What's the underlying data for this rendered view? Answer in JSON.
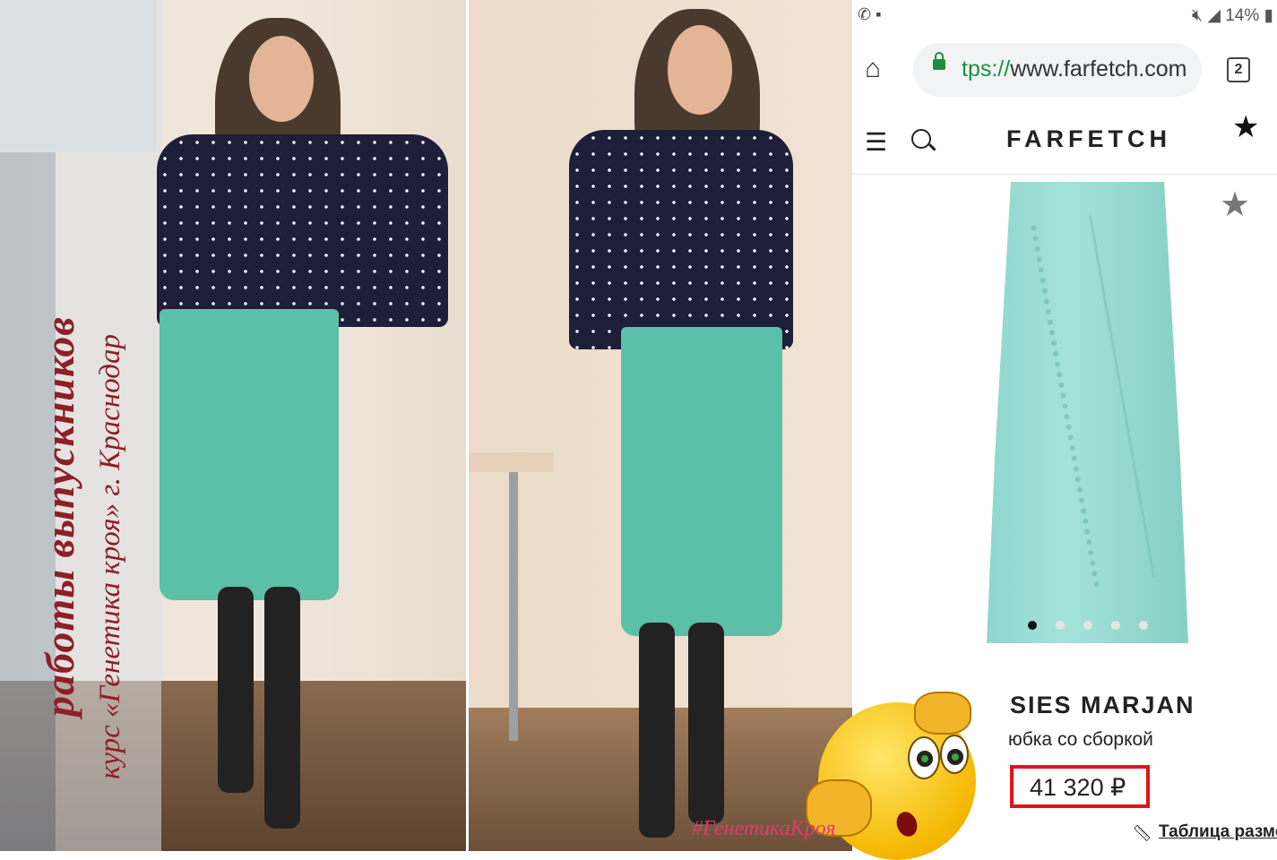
{
  "left_photo": {
    "vertical_title": "работы выпускников",
    "vertical_subtitle": "курс «Генетика кроя» г. Краснодар"
  },
  "hashtag": "#ГенетикаКроя",
  "status_bar": {
    "right_text": "14%",
    "icons": [
      "whatsapp-icon",
      "message-icon",
      "mute-icon",
      "wifi-icon",
      "signal-icon",
      "battery-icon"
    ]
  },
  "browser": {
    "url_protocol": "tps://",
    "url_host": "www.farfetch.com",
    "tab_count": "2"
  },
  "site": {
    "logo": "FARFETCH"
  },
  "product": {
    "brand": "SIES MARJAN",
    "name": "юбка со сборкой",
    "price": "41 320 ₽",
    "size_table_link": "Таблица разме",
    "image_dots_total": 5,
    "image_dots_active": 1
  },
  "colors": {
    "title_red": "#8c1f27",
    "price_box": "#e2131a",
    "skirt": "#5cbfa8",
    "secure_green": "#1e8e3e"
  }
}
